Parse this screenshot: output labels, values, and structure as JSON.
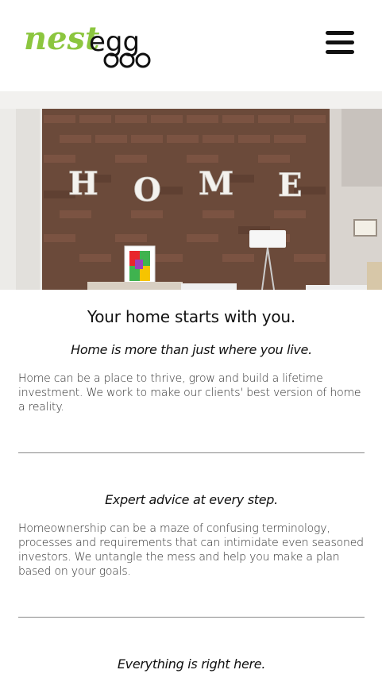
{
  "header": {
    "logo_text_left": "nest",
    "logo_text_right": "egg",
    "menu_icon": "hamburger-menu-icon"
  },
  "hero": {
    "letters": [
      "H",
      "O",
      "M",
      "E"
    ],
    "image_alt": "Brick wall living room with HOME letters"
  },
  "sections": [
    {
      "title": "Your home starts with you.",
      "subtitle": "Home is more than just where you live.",
      "body": "Home can be a place to thrive, grow and build a lifetime investment. We work to make our clients' best version of home a reality."
    },
    {
      "subtitle": "Expert advice at every step.",
      "body": "Homeownership can be a maze of confusing terminology, processes and requirements that can intimidate even seasoned investors. We untangle the mess and help you make a plan based on your goals."
    },
    {
      "subtitle": "Everything is right here."
    }
  ],
  "colors": {
    "logo_green": "#8cc63f",
    "text": "#111111",
    "divider": "#888888"
  }
}
